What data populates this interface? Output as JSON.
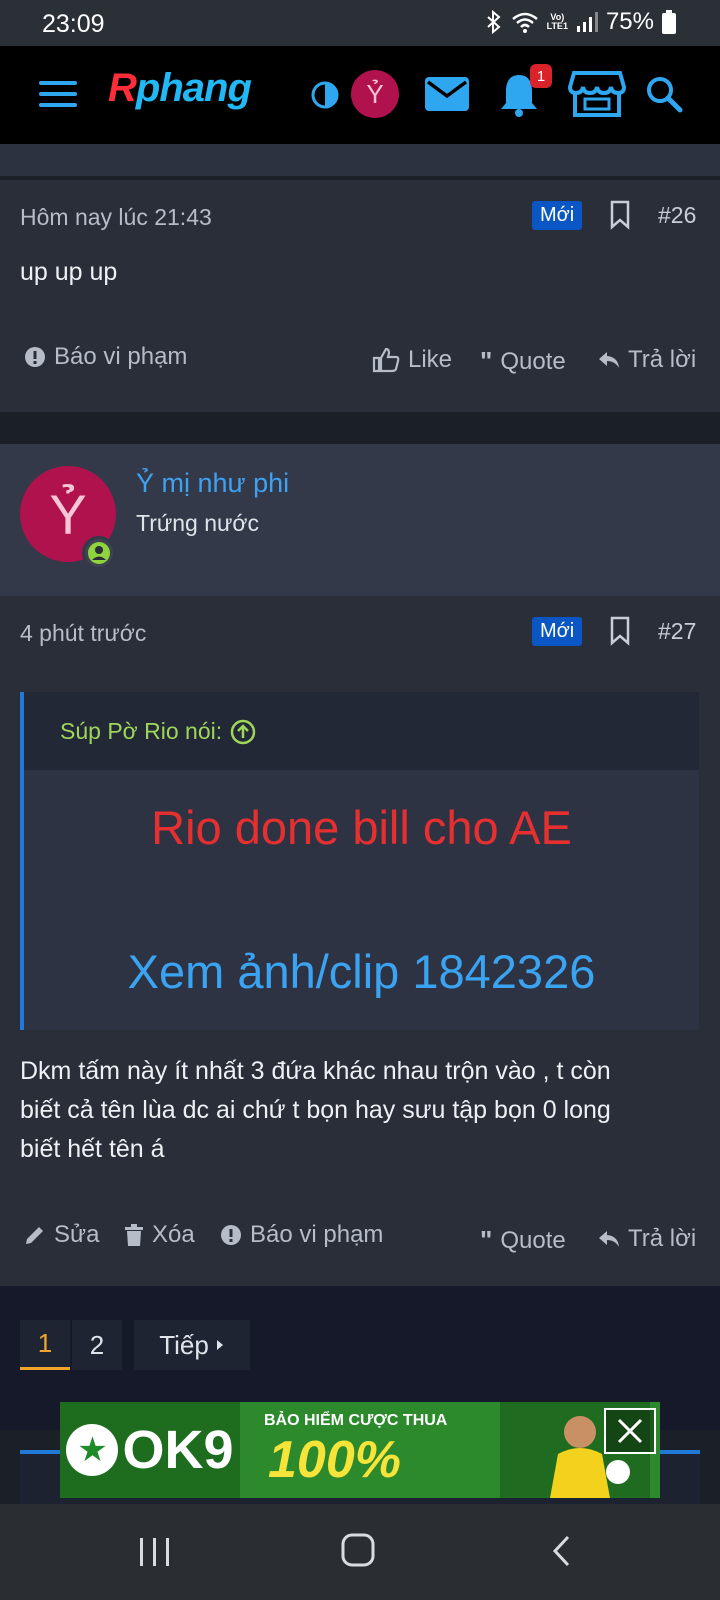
{
  "status_bar": {
    "time": "23:09",
    "lte_top": "Vo)",
    "lte_bottom": "LTE1",
    "battery": "75%"
  },
  "header": {
    "logo_r": "R",
    "logo_rest": "phang",
    "avatar_letter": "Ỷ",
    "notification_count": "1"
  },
  "post26": {
    "time": "Hôm nay lúc 21:43",
    "badge": "Mới",
    "number": "#26",
    "text": "up up up",
    "report": "Báo vi phạm",
    "like": "Like",
    "quote": "Quote",
    "reply": "Trả lời"
  },
  "user": {
    "avatar_letter": "Ỷ",
    "name": "Ỷ mị như phi",
    "title": "Trứng nước"
  },
  "post27": {
    "time": "4 phút trước",
    "badge": "Mới",
    "number": "#27",
    "quote_author": "Súp Pờ Rio nói:",
    "quote_line1": "Rio done bill cho AE",
    "quote_line2": "Xem ảnh/clip 1842326",
    "text_lines": [
      "Dkm tấm này ít nhất 3 đứa khác nhau trộn vào , t còn",
      "biết cả tên lùa dc ai chứ t bọn hay sưu tập bọn 0 long",
      "biết hết tên á"
    ],
    "edit": "Sửa",
    "delete": "Xóa",
    "report": "Báo vi phạm",
    "quote": "Quote",
    "reply": "Trả lời"
  },
  "pagination": {
    "page1": "1",
    "page2": "2",
    "next": "Tiếp"
  },
  "ad": {
    "brand": "OK9",
    "headline": "BẢO HIỂM CƯỢC THUA",
    "percent": "100%"
  },
  "colors": {
    "accent_blue": "#3fa2f0",
    "badge_blue": "#0a56c4",
    "quote_red": "#e63030",
    "quote_green": "#9fd65a",
    "active_page": "#f0a52a"
  }
}
